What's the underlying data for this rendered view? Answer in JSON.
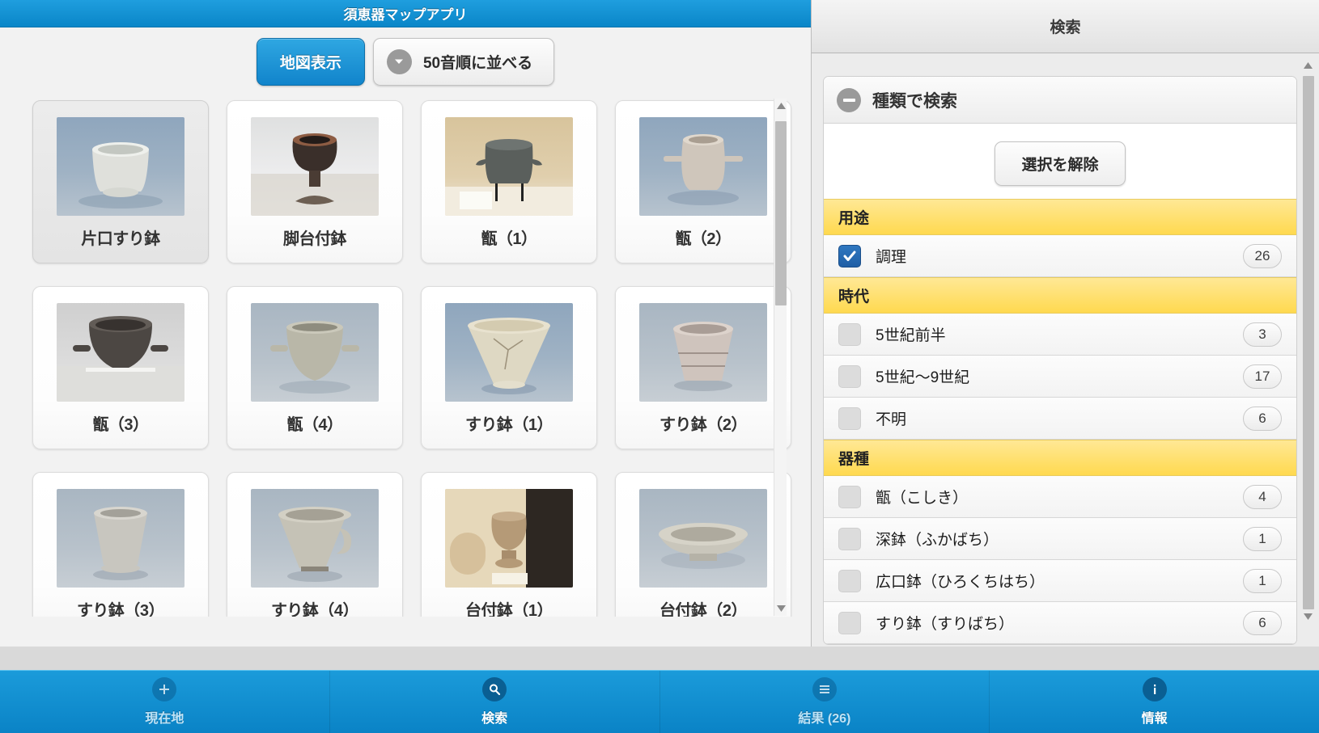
{
  "left": {
    "title": "須恵器マップアプリ",
    "toolbar": {
      "map_button": "地図表示",
      "sort_button": "50音順に並べる",
      "sort_icon": "chevron-down-icon"
    },
    "items": [
      {
        "label": "片口すり鉢",
        "selected": true,
        "art": "katakuchi",
        "bg": "bg-blue"
      },
      {
        "label": "脚台付鉢",
        "selected": false,
        "art": "kyakudai",
        "bg": "bg-white"
      },
      {
        "label": "甑（1）",
        "selected": false,
        "art": "koshiki1",
        "bg": "bg-tan"
      },
      {
        "label": "甑（2）",
        "selected": false,
        "art": "koshiki2",
        "bg": "bg-blue"
      },
      {
        "label": "甑（3）",
        "selected": false,
        "art": "koshiki3",
        "bg": "bg-dark"
      },
      {
        "label": "甑（4）",
        "selected": false,
        "art": "koshiki4",
        "bg": "bg-grayb"
      },
      {
        "label": "すり鉢（1）",
        "selected": false,
        "art": "suribachi1",
        "bg": "bg-blue"
      },
      {
        "label": "すり鉢（2）",
        "selected": false,
        "art": "suribachi2",
        "bg": "bg-grayb"
      },
      {
        "label": "すり鉢（3）",
        "selected": false,
        "art": "suribachi3",
        "bg": "bg-grayb"
      },
      {
        "label": "すり鉢（4）",
        "selected": false,
        "art": "suribachi4",
        "bg": "bg-grayb"
      },
      {
        "label": "台付鉢（1）",
        "selected": false,
        "art": "daitsuki1",
        "bg": "bg-cream"
      },
      {
        "label": "台付鉢（2）",
        "selected": false,
        "art": "daitsuki2",
        "bg": "bg-grayb"
      }
    ],
    "scrollbar": {
      "up_icon": "triangle-up-icon",
      "down_icon": "triangle-down-icon"
    }
  },
  "right": {
    "title": "検索",
    "section_title": "種類で検索",
    "collapse_icon": "minus-circle-icon",
    "clear_button": "選択を解除",
    "groups": [
      {
        "name": "用途",
        "options": [
          {
            "label": "調理",
            "count": "26",
            "checked": true
          }
        ]
      },
      {
        "name": "時代",
        "options": [
          {
            "label": "5世紀前半",
            "count": "3",
            "checked": false
          },
          {
            "label": "5世紀～9世紀",
            "count": "17",
            "checked": false
          },
          {
            "label": "不明",
            "count": "6",
            "checked": false
          }
        ]
      },
      {
        "name": "器種",
        "options": [
          {
            "label": "甑（こしき）",
            "count": "4",
            "checked": false
          },
          {
            "label": "深鉢（ふかばち）",
            "count": "1",
            "checked": false
          },
          {
            "label": "広口鉢（ひろくちはち）",
            "count": "1",
            "checked": false
          },
          {
            "label": "すり鉢（すりばち）",
            "count": "6",
            "checked": false
          }
        ]
      }
    ]
  },
  "tabbar": [
    {
      "label": "現在地",
      "icon": "plus-icon",
      "active": false
    },
    {
      "label": "検索",
      "icon": "search-icon",
      "active": true
    },
    {
      "label": "結果 (26)",
      "icon": "list-icon",
      "active": false
    },
    {
      "label": "情報",
      "icon": "info-icon",
      "active": true
    }
  ],
  "colors": {
    "accent_blue": "#0a86c8",
    "group_header_yellow": "#ffd94f",
    "checkbox_checked": "#1f5fa6"
  }
}
